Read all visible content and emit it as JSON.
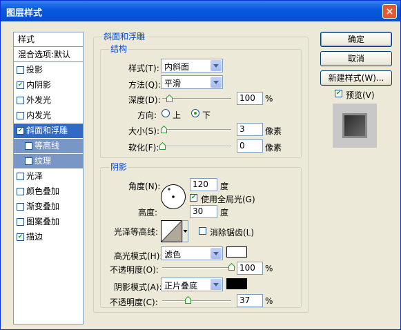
{
  "window": {
    "title": "图层样式",
    "close": "×"
  },
  "sidebar": {
    "header": "样式",
    "blend": "混合选项:默认",
    "items": [
      {
        "label": "投影",
        "checked": false
      },
      {
        "label": "内阴影",
        "checked": true
      },
      {
        "label": "外发光",
        "checked": false
      },
      {
        "label": "内发光",
        "checked": false
      },
      {
        "label": "斜面和浮雕",
        "checked": true
      },
      {
        "label": "等高线",
        "checked": false
      },
      {
        "label": "纹理",
        "checked": false
      },
      {
        "label": "光泽",
        "checked": false
      },
      {
        "label": "颜色叠加",
        "checked": false
      },
      {
        "label": "渐变叠加",
        "checked": false
      },
      {
        "label": "图案叠加",
        "checked": false
      },
      {
        "label": "描边",
        "checked": true
      }
    ]
  },
  "bevel": {
    "group_title": "斜面和浮雕",
    "structure": {
      "title": "结构",
      "style_label": "样式(T):",
      "style_value": "内斜面",
      "technique_label": "方法(Q):",
      "technique_value": "平滑",
      "depth_label": "深度(D):",
      "depth_value": "100",
      "depth_unit": "%",
      "depth_fraction": 0.1,
      "direction_label": "方向:",
      "dir_up": "上",
      "dir_down": "下",
      "size_label": "大小(S):",
      "size_value": "3",
      "size_unit": "像素",
      "size_fraction": 0.02,
      "soften_label": "软化(F):",
      "soften_value": "0",
      "soften_unit": "像素",
      "soften_fraction": 0.0
    },
    "shading": {
      "title": "阴影",
      "angle_label": "角度(N):",
      "angle_value": "120",
      "angle_unit": "度",
      "global_light_label": "使用全局光(G)",
      "global_light_checked": true,
      "altitude_label": "高度:",
      "altitude_value": "30",
      "altitude_unit": "度",
      "gloss_contour_label": "光泽等高线:",
      "anti_aliased_label": "消除锯齿(L)",
      "anti_aliased_checked": false,
      "highlight_mode_label": "高光模式(H):",
      "highlight_mode_value": "滤色",
      "highlight_color": "#ffffff",
      "highlight_opacity_label": "不透明度(O):",
      "highlight_opacity_value": "100",
      "highlight_opacity_unit": "%",
      "highlight_opacity_fraction": 1.0,
      "shadow_mode_label": "阴影模式(A):",
      "shadow_mode_value": "正片叠底",
      "shadow_color": "#000000",
      "shadow_opacity_label": "不透明度(C):",
      "shadow_opacity_value": "37",
      "shadow_opacity_unit": "%",
      "shadow_opacity_fraction": 0.37
    }
  },
  "buttons": {
    "ok": "确定",
    "cancel": "取消",
    "new_style": "新建样式(W)...",
    "preview_label": "预览(V)",
    "preview_checked": true
  },
  "colors": {
    "accent": "#316ac5",
    "legend": "#0046d5",
    "check": "#21a121"
  }
}
